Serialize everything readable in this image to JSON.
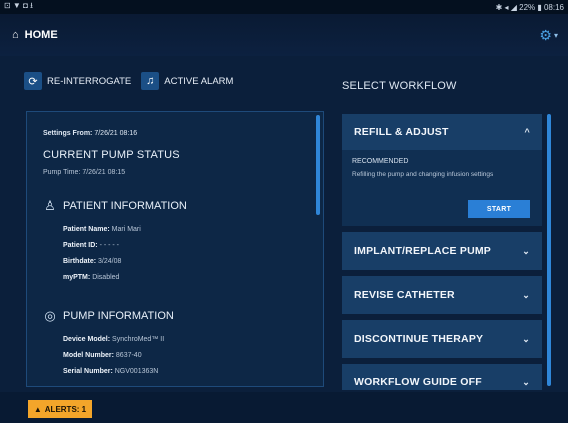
{
  "status_bar": {
    "left": "⊡ ▼ ◘ ⭳",
    "right": "✱ ◂ ◢ 22% ▮ 08:16"
  },
  "appbar": {
    "title": "HOME",
    "home_icon": "home-icon",
    "settings_icon": "gear-icon"
  },
  "actions": {
    "reinterrogate": "RE-INTERROGATE",
    "active_alarm": "ACTIVE ALARM"
  },
  "status": {
    "settings_label": "Settings From:",
    "settings_value": "7/26/21 08:16",
    "heading": "CURRENT PUMP STATUS",
    "pump_time_label": "Pump Time:",
    "pump_time_value": "7/26/21 08:15"
  },
  "patient": {
    "heading": "PATIENT INFORMATION",
    "name_label": "Patient Name:",
    "name_value": "Mari Mari",
    "id_label": "Patient ID:",
    "id_value": "- - - - -",
    "birthdate_label": "Birthdate:",
    "birthdate_value": "3/24/08",
    "myptm_label": "myPTM:",
    "myptm_value": "Disabled"
  },
  "pump": {
    "heading": "PUMP INFORMATION",
    "device_label": "Device Model:",
    "device_value": "SynchroMed™ II",
    "model_label": "Model Number:",
    "model_value": "8637-40",
    "serial_label": "Serial Number:",
    "serial_value": "NGV001363N"
  },
  "workflow": {
    "title": "SELECT WORKFLOW",
    "items": [
      {
        "label": "REFILL & ADJUST",
        "chevron": "^"
      },
      {
        "label": "IMPLANT/REPLACE PUMP",
        "chevron": "⌄"
      },
      {
        "label": "REVISE CATHETER",
        "chevron": "⌄"
      },
      {
        "label": "DISCONTINUE THERAPY",
        "chevron": "⌄"
      },
      {
        "label": "WORKFLOW GUIDE OFF",
        "chevron": "⌄"
      }
    ],
    "expanded": {
      "recommended": "RECOMMENDED",
      "description": "Refilling the pump and changing infusion settings",
      "start_label": "START"
    }
  },
  "footer": {
    "alerts_label": "ALERTS: 1"
  },
  "colors": {
    "background": "#0b1f3b",
    "accent": "#2a7fd6",
    "alert": "#f3a52a"
  }
}
